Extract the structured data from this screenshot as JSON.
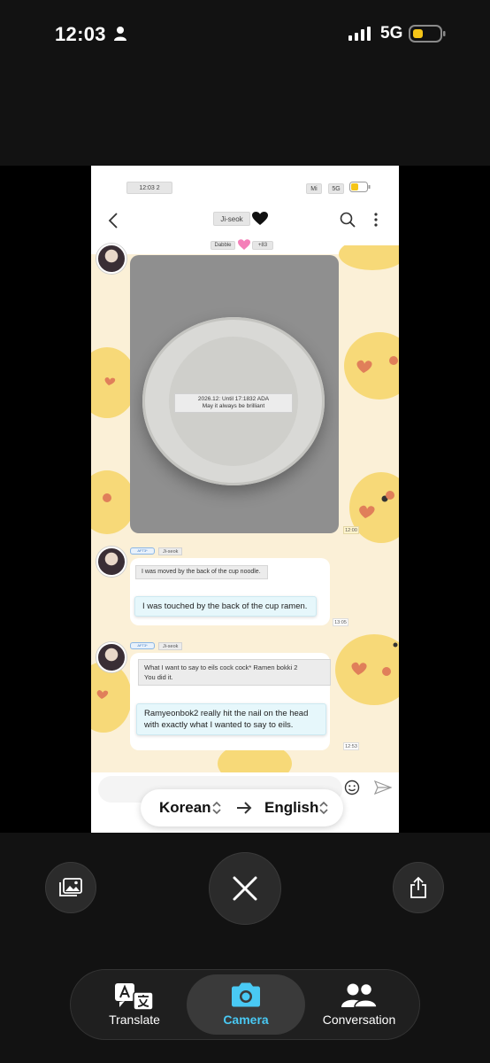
{
  "status_bar": {
    "time": "12:03",
    "network": "5G",
    "icons": [
      "person-icon",
      "signal-icon",
      "battery-icon"
    ],
    "battery_color": "#f5c518"
  },
  "preview": {
    "inner_status": {
      "time": "12:03 2",
      "carrier": "Mi",
      "network": "5G"
    },
    "chat_header": {
      "title": "Ji-seok",
      "title_emoji": "black-heart-icon",
      "sub_left": "Dabble",
      "sub_right": "+83"
    },
    "photo_message": {
      "label_line1": "2026.12: Until 17:1832 ADA",
      "label_line2": "May it always be brilliant",
      "time": "12:00"
    },
    "messages": [
      {
        "tag": "AFT3*",
        "sender": "Ji-seok",
        "original": "I was moved by the back of the cup noodle.",
        "translation": "I was touched by the back of the cup ramen.",
        "time": "13:05"
      },
      {
        "tag": "AFT3*",
        "sender": "Ji-seok",
        "original_line1": "What I want to say to eils cock cock* Ramen bokki 2",
        "original_line2": "You did it.",
        "translation_line1": "Ramyeonbok2 really hit the nail on the head",
        "translation_line2": "with exactly what I wanted to say to eils.",
        "time": "12:53"
      }
    ],
    "languages": {
      "source": "Korean",
      "target": "English"
    }
  },
  "controls": {
    "buttons": [
      "gallery-icon",
      "close-icon",
      "share-icon"
    ],
    "modes": [
      {
        "label": "Translate",
        "icon": "translate-icon",
        "active": false
      },
      {
        "label": "Camera",
        "icon": "camera-icon",
        "active": true
      },
      {
        "label": "Conversation",
        "icon": "conversation-icon",
        "active": false
      }
    ],
    "accent_color": "#49c9f4"
  }
}
